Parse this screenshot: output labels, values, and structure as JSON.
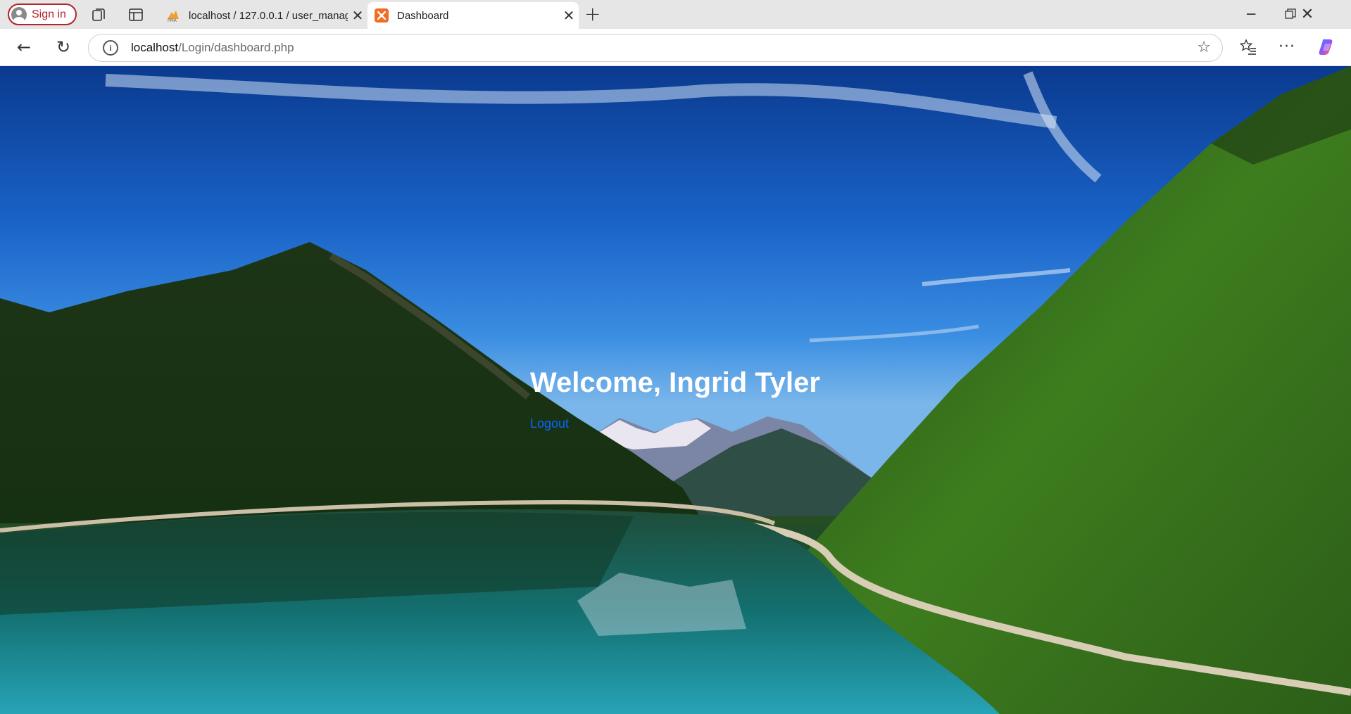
{
  "browser": {
    "signin_label": "Sign in",
    "tabs": [
      {
        "title": "localhost / 127.0.0.1 / user_manag",
        "icon": "phpmyadmin-icon",
        "active": false
      },
      {
        "title": "Dashboard",
        "icon": "xampp-icon",
        "active": true
      }
    ],
    "address": {
      "host": "localhost",
      "path": "/Login/dashboard.php"
    }
  },
  "page": {
    "welcome": "Welcome, Ingrid Tyler",
    "logout_label": "Logout"
  },
  "colors": {
    "link": "#0a66ff",
    "signin_accent": "#b4232a"
  }
}
